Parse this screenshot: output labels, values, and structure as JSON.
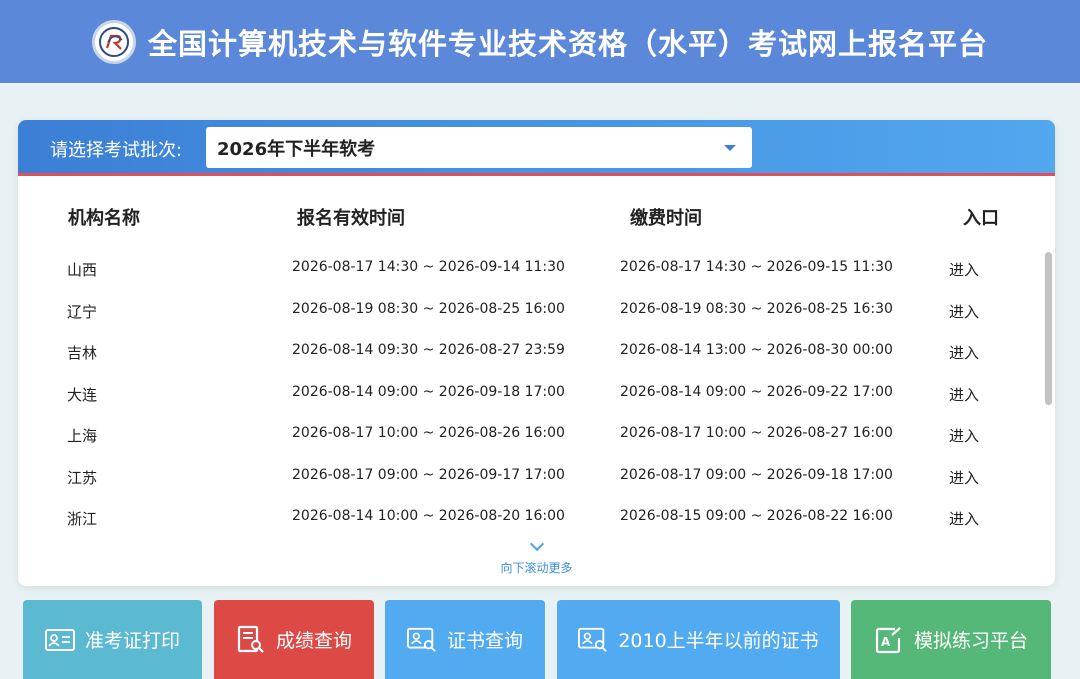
{
  "header": {
    "title": "全国计算机技术与软件专业技术资格（水平）考试网上报名平台",
    "logo_icon": "exam-logo-icon"
  },
  "batch": {
    "label": "请选择考试批次:",
    "selected": "2026年下半年软考"
  },
  "table": {
    "headers": [
      "机构名称",
      "报名有效时间",
      "缴费时间",
      "入口"
    ],
    "rows": [
      {
        "name": "山西",
        "reg": "2026-08-17 14:30 ~ 2026-09-14 11:30",
        "pay": "2026-08-17 14:30 ~ 2026-09-15 11:30",
        "entry": "进入"
      },
      {
        "name": "辽宁",
        "reg": "2026-08-19 08:30 ~ 2026-08-25 16:00",
        "pay": "2026-08-19 08:30 ~ 2026-08-25 16:30",
        "entry": "进入"
      },
      {
        "name": "吉林",
        "reg": "2026-08-14 09:30 ~ 2026-08-27 23:59",
        "pay": "2026-08-14 13:00 ~ 2026-08-30 00:00",
        "entry": "进入"
      },
      {
        "name": "大连",
        "reg": "2026-08-14 09:00 ~ 2026-09-18 17:00",
        "pay": "2026-08-14 09:00 ~ 2026-09-22 17:00",
        "entry": "进入"
      },
      {
        "name": "上海",
        "reg": "2026-08-17 10:00 ~ 2026-08-26 16:00",
        "pay": "2026-08-17 10:00 ~ 2026-08-27 16:00",
        "entry": "进入"
      },
      {
        "name": "江苏",
        "reg": "2026-08-17 09:00 ~ 2026-09-17 17:00",
        "pay": "2026-08-17 09:00 ~ 2026-09-18 17:00",
        "entry": "进入"
      },
      {
        "name": "浙江",
        "reg": "2026-08-14 10:00 ~ 2026-08-20 16:00",
        "pay": "2026-08-15 09:00 ~ 2026-08-22 16:00",
        "entry": "进入"
      }
    ]
  },
  "scroll_more": "向下滚动更多",
  "buttons": [
    {
      "label": "准考证打印",
      "icon": "id-card-icon",
      "color": "#5cb9d2"
    },
    {
      "label": "成绩查询",
      "icon": "report-search-icon",
      "color": "#dd4a46"
    },
    {
      "label": "证书查询",
      "icon": "certificate-search-icon",
      "color": "#52aaf0"
    },
    {
      "label": "2010上半年以前的证书",
      "icon": "certificate-search-icon",
      "color": "#52aaf0"
    },
    {
      "label": "模拟练习平台",
      "icon": "practice-edit-icon",
      "color": "#55b878"
    }
  ],
  "colors": {
    "header_bg": "#5c88d9",
    "accent_red": "#e0505a",
    "accent_blue": "#3c7fd6"
  }
}
